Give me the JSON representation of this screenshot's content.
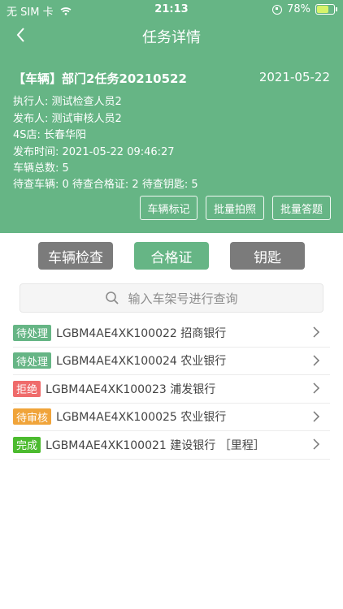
{
  "status": {
    "carrier": "无 SIM 卡",
    "time": "21:13",
    "battery": "78%",
    "battery_level": 0.78
  },
  "nav": {
    "title": "任务详情"
  },
  "task": {
    "title": "【车辆】部门2任务20210522",
    "date": "2021-05-22",
    "executor": "执行人: 测试检查人员2",
    "publisher": "发布人: 测试审核人员2",
    "store": "4S店: 长春华阳",
    "publish_time": "发布时间: 2021-05-22 09:46:27",
    "vehicle_total": "车辆总数: 5",
    "pending": "待查车辆: 0   待查合格证: 2   待查钥匙: 5"
  },
  "actions": {
    "mark": "车辆标记",
    "batch_photo": "批量拍照",
    "batch_answer": "批量答题"
  },
  "tabs": [
    {
      "label": "车辆检查",
      "active": false
    },
    {
      "label": "合格证",
      "active": true
    },
    {
      "label": "钥匙",
      "active": false
    }
  ],
  "search": {
    "placeholder": "输入车架号进行查询"
  },
  "list": [
    {
      "status": "待处理",
      "color": "#66b585",
      "text": "LGBM4AE4XK100022   招商银行"
    },
    {
      "status": "待处理",
      "color": "#66b585",
      "text": "LGBM4AE4XK100024   农业银行"
    },
    {
      "status": "拒绝",
      "color": "#ef6b6b",
      "text": "LGBM4AE4XK100023   浦发银行"
    },
    {
      "status": "待审核",
      "color": "#f0a43a",
      "text": "LGBM4AE4XK100025   农业银行"
    },
    {
      "status": "完成",
      "color": "#4cbb2f",
      "text": "LGBM4AE4XK100021   建设银行 ［里程］"
    }
  ],
  "colors": {
    "primary": "#66b585",
    "tab_inactive": "#7b7b7b"
  }
}
